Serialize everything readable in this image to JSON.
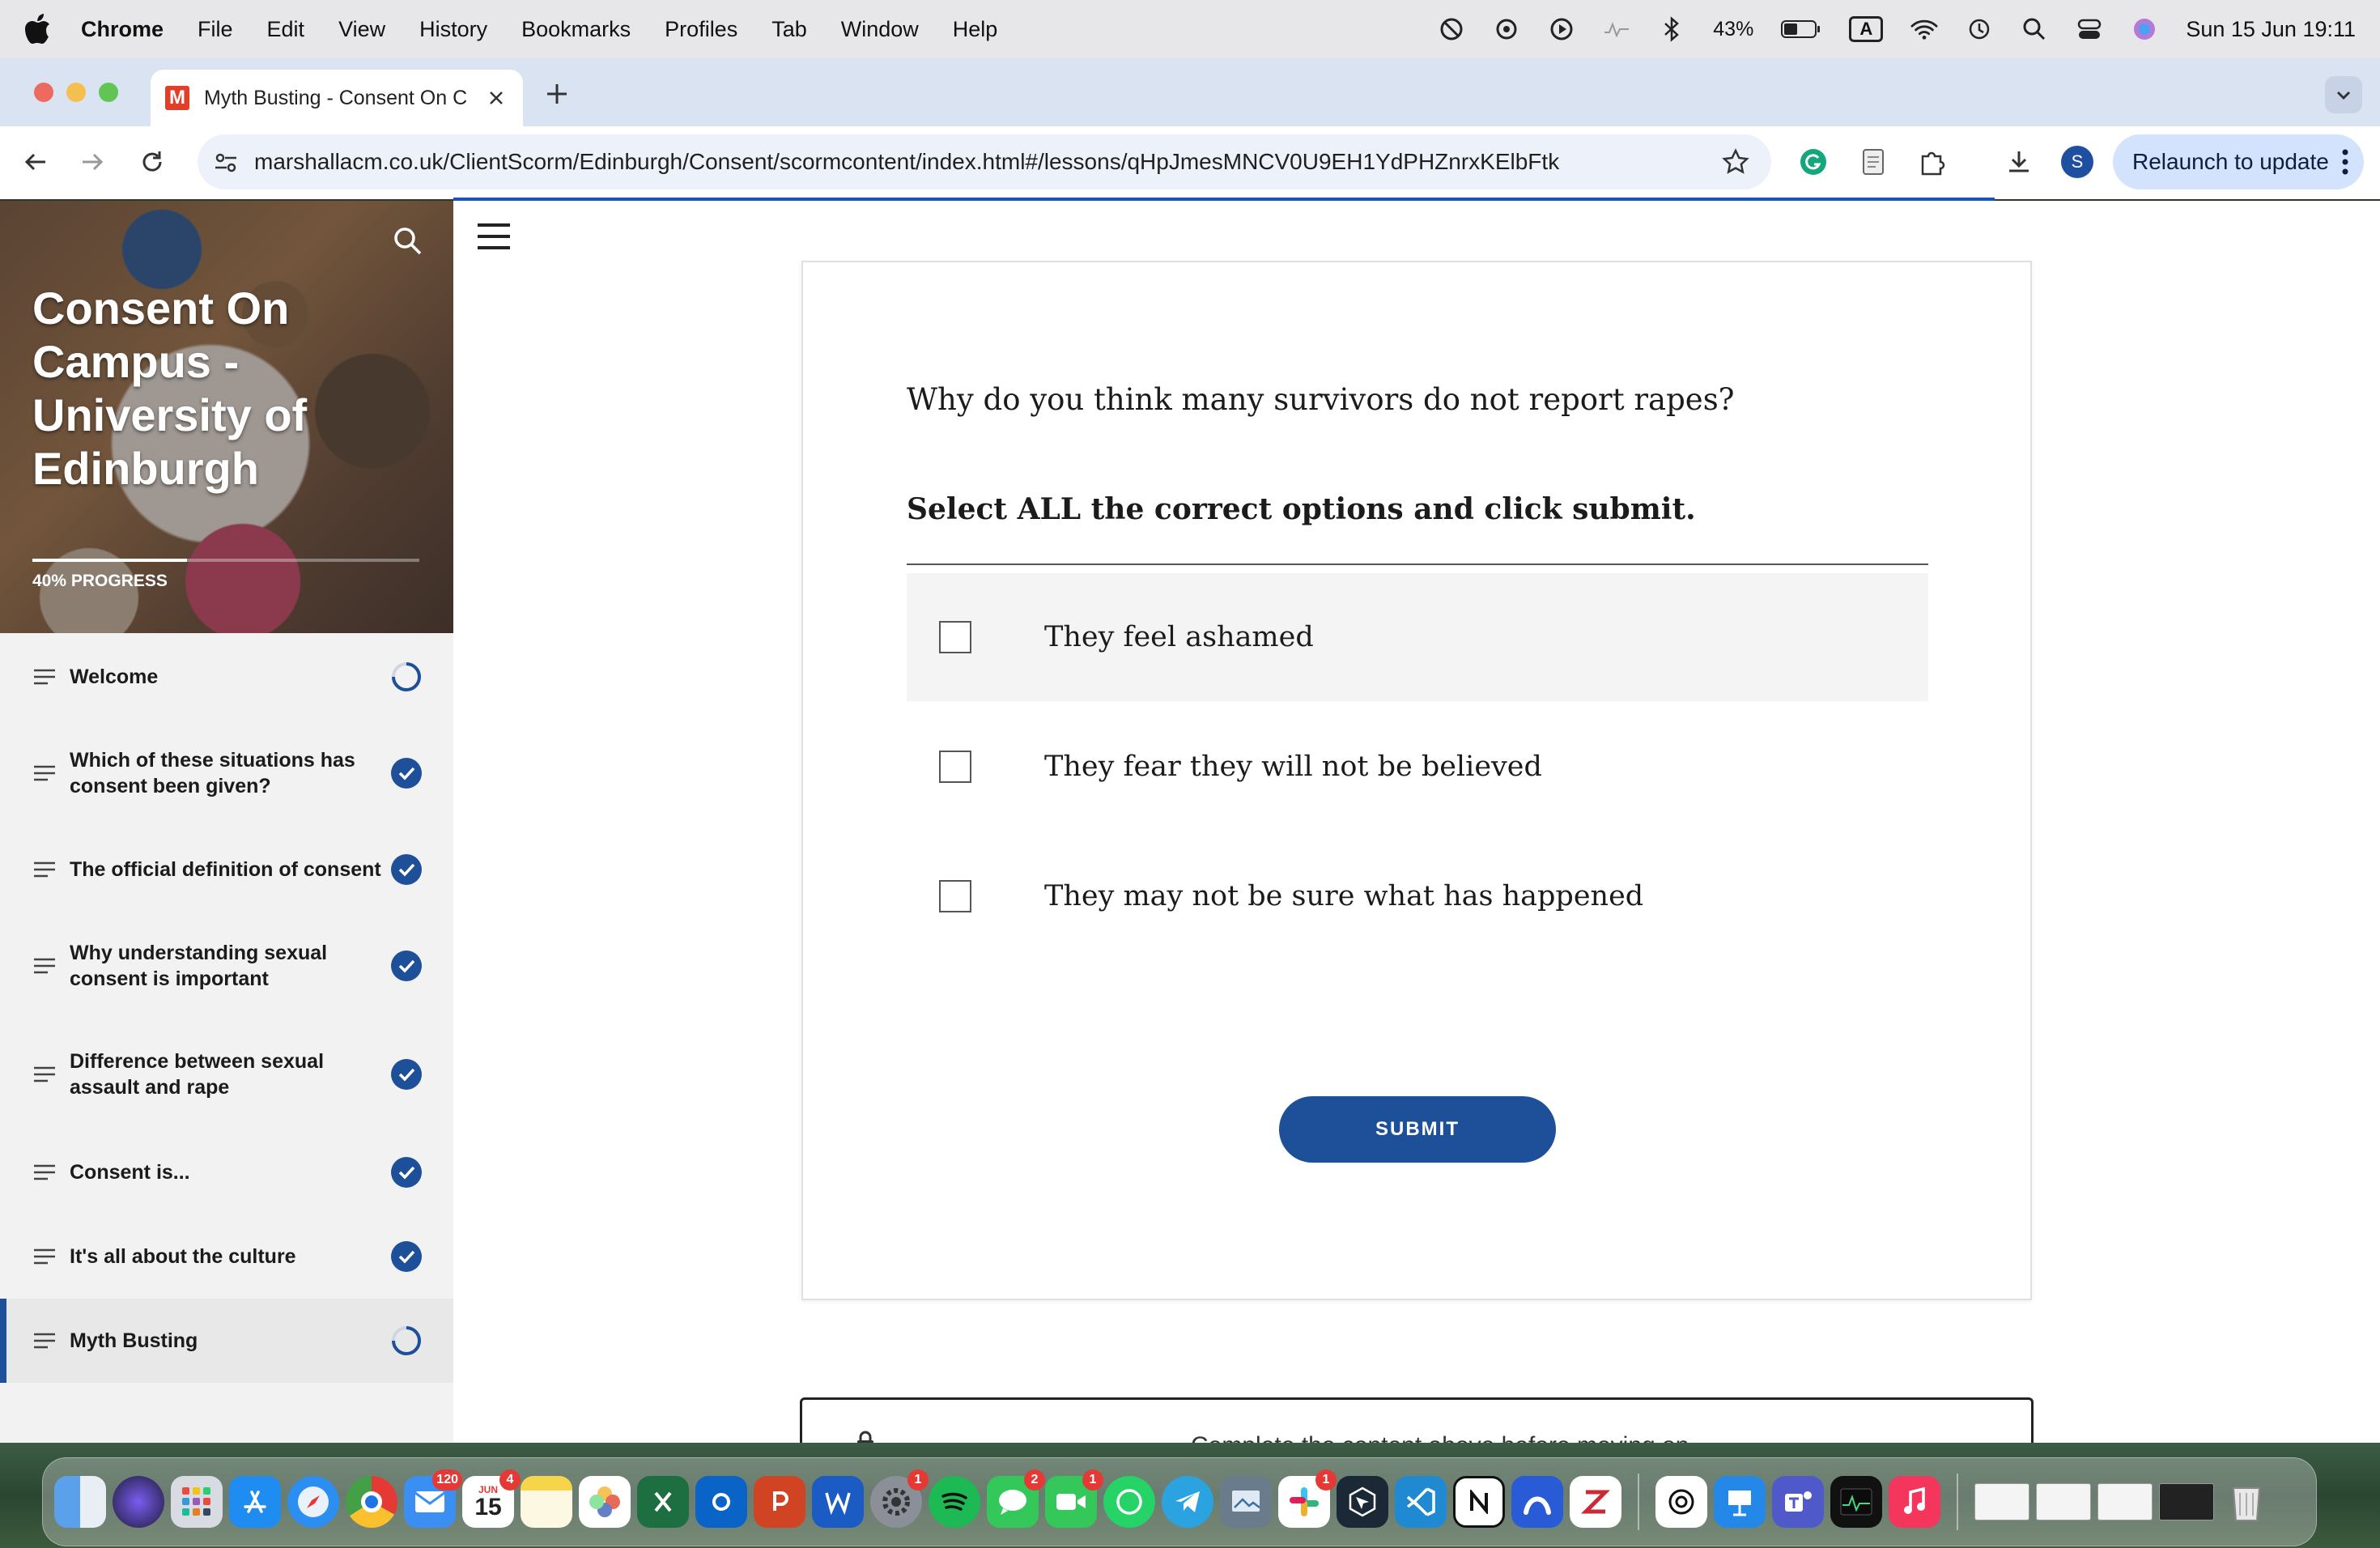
{
  "menubar": {
    "app_name": "Chrome",
    "menus": [
      "File",
      "Edit",
      "View",
      "History",
      "Bookmarks",
      "Profiles",
      "Tab",
      "Window",
      "Help"
    ],
    "battery": "43%",
    "keyboard": "A",
    "datetime": "Sun 15 Jun  19:11"
  },
  "browser": {
    "tab_title": "Myth Busting - Consent On C",
    "tab_favicon": "M",
    "url": "marshallacm.co.uk/ClientScorm/Edinburgh/Consent/scormcontent/index.html#/lessons/qHpJmesMNCV0U9EH1YdPHZnrxKElbFtk",
    "profile_initial": "S",
    "relaunch_label": "Relaunch to update"
  },
  "course": {
    "title": "Consent On Campus - University of Edinburgh",
    "progress_label": "40% PROGRESS",
    "progress_fraction": 0.4
  },
  "lessons": [
    {
      "label": "Welcome",
      "status": "in-progress"
    },
    {
      "label": "Which of these situations has consent been given?",
      "status": "complete"
    },
    {
      "label": "The official definition of consent",
      "status": "complete"
    },
    {
      "label": "Why understanding sexual consent is important",
      "status": "complete"
    },
    {
      "label": "Difference between sexual assault and rape",
      "status": "complete"
    },
    {
      "label": "Consent is...",
      "status": "complete"
    },
    {
      "label": "It's all about the culture",
      "status": "complete"
    },
    {
      "label": "Myth Busting",
      "status": "in-progress",
      "active": true
    }
  ],
  "quiz": {
    "question": "Why do you think many survivors do not report rapes?",
    "instruction": "Select ALL the correct options and click submit.",
    "options": [
      {
        "label": "They feel ashamed",
        "checked": false
      },
      {
        "label": "They fear they will not be believed",
        "checked": false
      },
      {
        "label": "They may not be sure what has happened",
        "checked": false
      }
    ],
    "submit_label": "SUBMIT"
  },
  "next_block_hint": "Complete the content above before moving on.",
  "dock": {
    "calendar_month": "JUN",
    "calendar_day": "15",
    "badges": {
      "mail": "120",
      "calendar": "4",
      "settings": "1",
      "messages": "2",
      "facetime": "1",
      "slack": "1"
    }
  },
  "colors": {
    "accent": "#1e4f99",
    "menubar": "#e7e7ea",
    "tabstrip": "#dae3f1"
  }
}
